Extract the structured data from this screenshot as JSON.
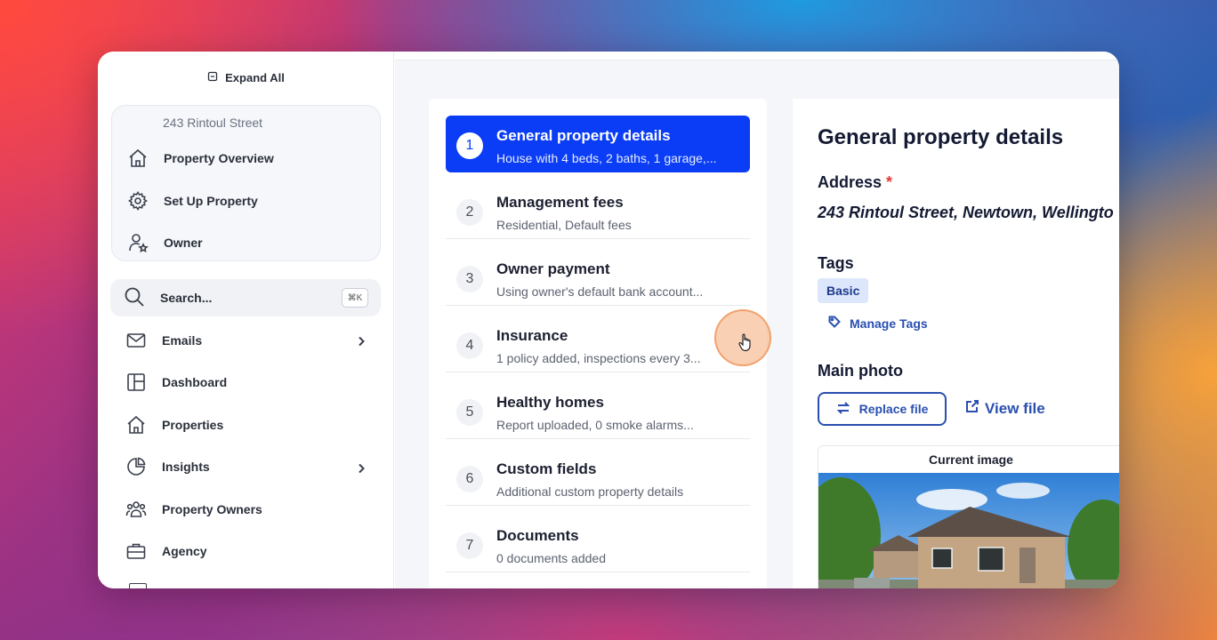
{
  "sidebar": {
    "expand_all": "Expand All",
    "property_card": {
      "address": "243 Rintoul Street",
      "items": [
        {
          "label": "Property Overview",
          "icon": "house-icon"
        },
        {
          "label": "Set Up Property",
          "icon": "gear-icon"
        },
        {
          "label": "Owner",
          "icon": "user-star-icon"
        }
      ]
    },
    "search": {
      "label": "Search...",
      "shortcut": "⌘K"
    },
    "nav": [
      {
        "label": "Emails",
        "icon": "mail-icon",
        "has_chevron": true
      },
      {
        "label": "Dashboard",
        "icon": "layout-icon",
        "has_chevron": false
      },
      {
        "label": "Properties",
        "icon": "house-icon",
        "has_chevron": false
      },
      {
        "label": "Insights",
        "icon": "pie-chart-icon",
        "has_chevron": true
      },
      {
        "label": "Property Owners",
        "icon": "users-icon",
        "has_chevron": false
      },
      {
        "label": "Agency",
        "icon": "briefcase-icon",
        "has_chevron": false
      }
    ]
  },
  "steps": [
    {
      "num": "1",
      "title": "General property details",
      "sub": "House with 4 beds, 2 baths, 1 garage,..."
    },
    {
      "num": "2",
      "title": "Management fees",
      "sub": "Residential, Default fees"
    },
    {
      "num": "3",
      "title": "Owner payment",
      "sub": "Using owner's default bank account..."
    },
    {
      "num": "4",
      "title": "Insurance",
      "sub": "1 policy added, inspections every 3..."
    },
    {
      "num": "5",
      "title": "Healthy homes",
      "sub": "Report uploaded, 0 smoke alarms..."
    },
    {
      "num": "6",
      "title": "Custom fields",
      "sub": "Additional custom property details"
    },
    {
      "num": "7",
      "title": "Documents",
      "sub": "0 documents added"
    }
  ],
  "details": {
    "title": "General property details",
    "address_label": "Address",
    "required_mark": "*",
    "address_value": "243 Rintoul Street, Newtown, Wellingto",
    "tags_label": "Tags",
    "tag": "Basic",
    "manage_tags": "Manage Tags",
    "main_photo_label": "Main photo",
    "replace_file": "Replace file",
    "view_file": "View file",
    "current_image": "Current image"
  },
  "colors": {
    "accent": "#0a3df5",
    "link": "#2a4fb0",
    "tag_bg": "#dde7fb"
  }
}
